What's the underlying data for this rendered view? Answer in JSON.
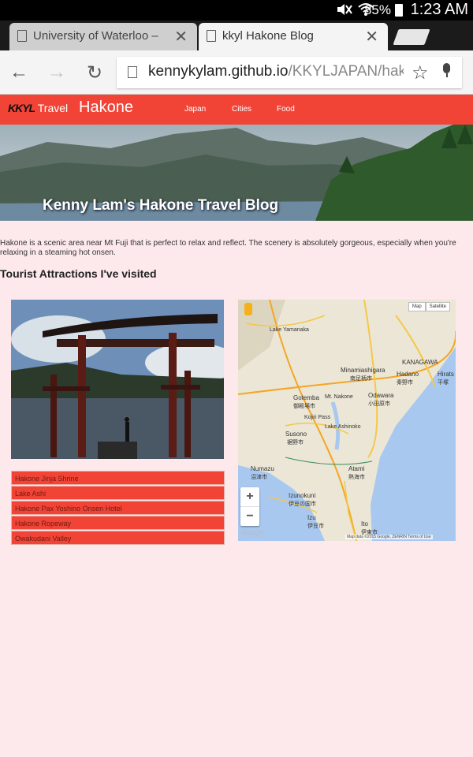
{
  "status_bar": {
    "battery_percent": "85%",
    "time": "1:23 AM"
  },
  "tabs": [
    {
      "title": "University of Waterloo – Ce",
      "active": false
    },
    {
      "title": "kkyl Hakone Blog",
      "active": true
    }
  ],
  "toolbar": {
    "url_host": "kennykylam.github.io",
    "url_path": "/KKYLJAPAN/hako"
  },
  "site": {
    "brand_logo": "KKYL",
    "brand_label": "Travel",
    "title": "Hakone",
    "nav": [
      "Japan",
      "Cities",
      "Food"
    ],
    "accent_color": "#f24436"
  },
  "hero": {
    "title": "Kenny Lam's Hakone Travel Blog"
  },
  "intro": "Hakone is a scenic area near Mt Fuji that is perfect to relax and reflect. The scenery is absolutely gorgeous, especially when you're relaxing in a steaming hot onsen.",
  "section_title": "Tourist Attractions I've visited",
  "attractions": [
    "Hakone Jinja Shrine",
    "Lake Ashi",
    "Hakone Pax Yoshino Onsen Hotel",
    "Hakone Ropeway",
    "Owakudani Valley"
  ],
  "map": {
    "type_buttons": [
      "Map",
      "Satellite"
    ],
    "labels": {
      "kanagawa": "KANAGAWA",
      "gotemba": "Gotemba",
      "gotemba_jp": "御殿場市",
      "minamiashigara": "Minamiashigara",
      "minamiashigara_jp": "南足柄市",
      "hadano": "Hadano",
      "hadano_jp": "秦野市",
      "odawara": "Odawara",
      "odawara_jp": "小田原市",
      "mt_nakone": "Mt. Nakone",
      "kojiri_pass": "Kojiri Pass",
      "lake_ashinoko": "Lake Ashinoko",
      "susono": "Susono",
      "susono_jp": "裾野市",
      "numazu": "Numazu",
      "numazu_jp": "沼津市",
      "atami": "Atami",
      "atami_jp": "熱海市",
      "izunokuni": "Izunokuni",
      "izunokuni_jp": "伊豆の国市",
      "izu": "Izu",
      "izu_jp": "伊豆市",
      "ito": "Ito",
      "ito_jp": "伊東市",
      "lake_yamanaka": "Lake Yamanaka",
      "hiratsuka": "Hirats",
      "hiratsuka_jp": "平塚"
    },
    "zoom_in": "+",
    "zoom_out": "−",
    "google": "Google",
    "footer": "Map data ©2015 Google, ZENRIN   Terms of Use"
  }
}
